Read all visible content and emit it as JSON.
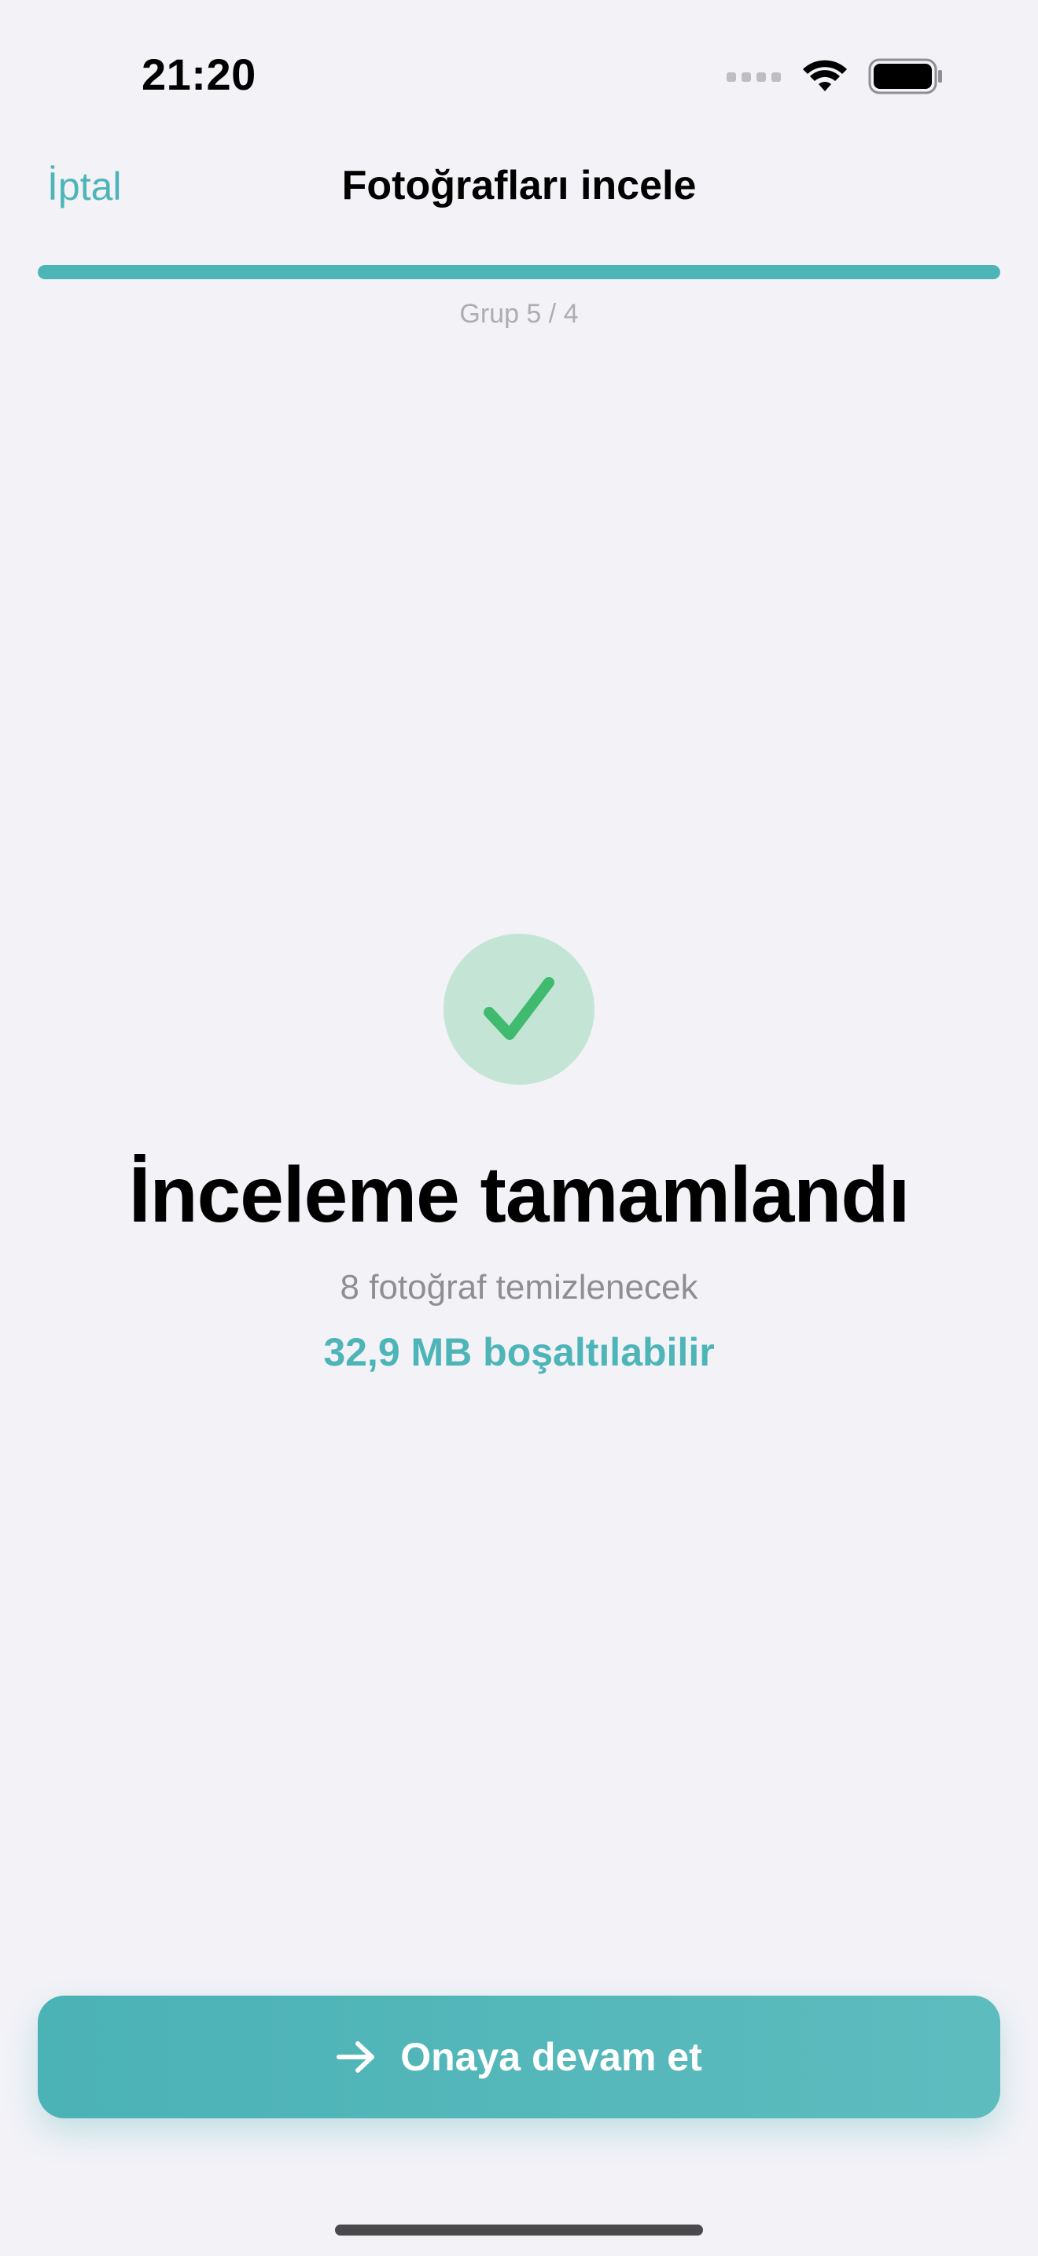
{
  "status_bar": {
    "time": "21:20",
    "icons": [
      "signal-icon",
      "wifi-icon",
      "battery-icon"
    ]
  },
  "nav": {
    "cancel_label": "İptal",
    "title": "Fotoğrafları incele"
  },
  "progress": {
    "label": "Grup 5 / 4",
    "fill_fraction": 1.0
  },
  "result": {
    "icon": "checkmark-icon",
    "headline": "İnceleme tamamlandı",
    "subline": "8 fotoğraf temizlenecek",
    "space_freed": "32,9 MB boşaltılabilir"
  },
  "cta": {
    "icon": "arrow-right-icon",
    "label": "Onaya devam et"
  },
  "colors": {
    "accent": "#4DB5B8",
    "success": "#3FBA6E",
    "success_bg": "#C4E5D6",
    "background": "#F2F2F7"
  }
}
